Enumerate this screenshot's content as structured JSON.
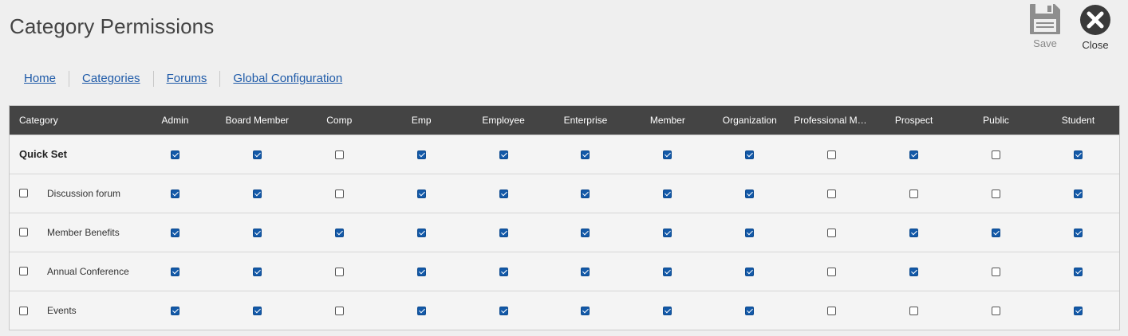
{
  "page": {
    "title": "Category Permissions"
  },
  "toolbar": {
    "save_label": "Save",
    "close_label": "Close"
  },
  "nav": [
    "Home",
    "Categories",
    "Forums",
    "Global Configuration"
  ],
  "table": {
    "category_header": "Category",
    "columns": [
      "Admin",
      "Board Member",
      "Comp",
      "Emp",
      "Employee",
      "Enterprise",
      "Member",
      "Organization",
      "Professional Me…",
      "Prospect",
      "Public",
      "Student"
    ],
    "quick_set": {
      "label": "Quick Set",
      "values": [
        true,
        true,
        false,
        true,
        true,
        true,
        true,
        true,
        false,
        true,
        false,
        true
      ]
    },
    "rows": [
      {
        "name": "Discussion forum",
        "selected": false,
        "values": [
          true,
          true,
          false,
          true,
          true,
          true,
          true,
          true,
          false,
          false,
          false,
          true
        ]
      },
      {
        "name": "Member Benefits",
        "selected": false,
        "values": [
          true,
          true,
          true,
          true,
          true,
          true,
          true,
          true,
          false,
          true,
          true,
          true
        ]
      },
      {
        "name": "Annual Conference",
        "selected": false,
        "values": [
          true,
          true,
          false,
          true,
          true,
          true,
          true,
          true,
          false,
          true,
          false,
          true
        ]
      },
      {
        "name": "Events",
        "selected": false,
        "values": [
          true,
          true,
          false,
          true,
          true,
          true,
          true,
          true,
          false,
          false,
          false,
          true
        ]
      }
    ]
  },
  "colors": {
    "accent": "#1359a8",
    "header_bg": "#444444",
    "link": "#1e5aa8"
  }
}
